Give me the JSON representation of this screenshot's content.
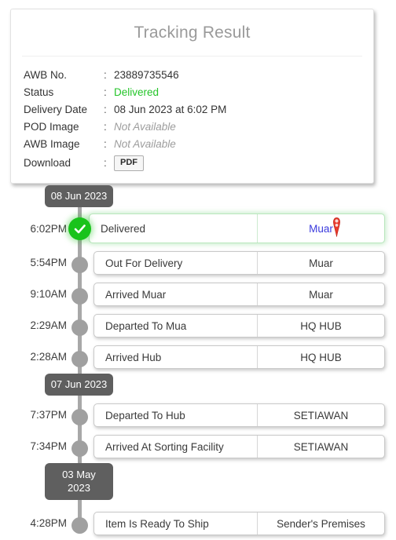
{
  "card": {
    "title": "Tracking Result",
    "rows": [
      {
        "label": "AWB No.",
        "colon": ":",
        "value": "23889735546",
        "style": "plain"
      },
      {
        "label": "Status",
        "colon": ":",
        "value": "Delivered",
        "style": "green"
      },
      {
        "label": "Delivery Date",
        "colon": ":",
        "value": "08 Jun 2023 at 6:02 PM",
        "style": "plain"
      },
      {
        "label": "POD Image",
        "colon": ":",
        "value": "Not Available",
        "style": "muted"
      },
      {
        "label": "AWB Image",
        "colon": ":",
        "value": "Not Available",
        "style": "muted"
      },
      {
        "label": "Download",
        "colon": ":",
        "value": "PDF",
        "style": "button"
      }
    ]
  },
  "timeline": {
    "groups": [
      {
        "date": "08 Jun 2023",
        "date_lines": [
          "08 Jun 2023"
        ],
        "events": [
          {
            "time": "6:02PM",
            "description": "Delivered",
            "location": "Muar",
            "state": "current",
            "icon": "check-circle-icon",
            "location_icon": "map-pin-icon"
          },
          {
            "time": "5:54PM",
            "description": "Out For Delivery",
            "location": "Muar",
            "state": "past",
            "icon": "dot-icon"
          },
          {
            "time": "9:10AM",
            "description": "Arrived Muar",
            "location": "Muar",
            "state": "past",
            "icon": "dot-icon"
          },
          {
            "time": "2:29AM",
            "description": "Departed To Mua",
            "location": "HQ HUB",
            "state": "past",
            "icon": "dot-icon"
          },
          {
            "time": "2:28AM",
            "description": "Arrived Hub",
            "location": "HQ HUB",
            "state": "past",
            "icon": "dot-icon"
          }
        ]
      },
      {
        "date": "07 Jun 2023",
        "date_lines": [
          "07 Jun 2023"
        ],
        "events": [
          {
            "time": "7:37PM",
            "description": "Departed To Hub",
            "location": "SETIAWAN",
            "state": "past",
            "icon": "dot-icon"
          },
          {
            "time": "7:34PM",
            "description": "Arrived At Sorting Facility",
            "location": "SETIAWAN",
            "state": "past",
            "icon": "dot-icon"
          }
        ]
      },
      {
        "date": "03 May 2023",
        "date_lines": [
          "03 May",
          "2023"
        ],
        "events": [
          {
            "time": "4:28PM",
            "description": "Item Is Ready To Ship",
            "location": "Sender's Premises",
            "state": "past",
            "icon": "dot-icon"
          }
        ]
      }
    ]
  },
  "colors": {
    "status_green": "#25c52a",
    "current_dot": "#19c31b",
    "past_dot": "#a0a0a0",
    "rail": "#a8a8a8",
    "date_chip_bg": "#5f5f5f",
    "current_location_text": "#3b3bdd",
    "pin": "#e8392c",
    "title": "#9a9a9a"
  }
}
